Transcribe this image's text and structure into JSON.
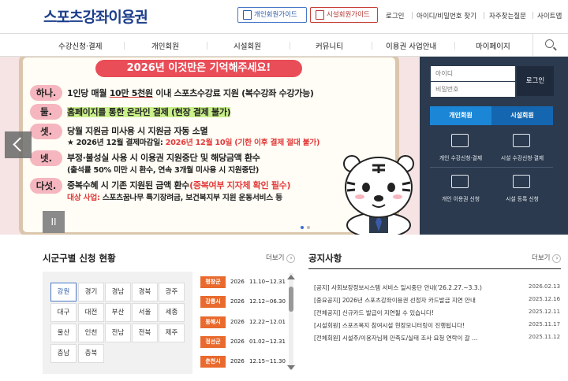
{
  "header": {
    "logo": "스포츠강좌이용권",
    "guide_personal": "개인회원가이드",
    "guide_facility": "시설회원가이드",
    "util": [
      "로그인",
      "아이디/비밀번호 찾기",
      "자주찾는질문",
      "사이트맵"
    ]
  },
  "nav": {
    "items": [
      "수강신청·결제",
      "개인회원",
      "시설회원",
      "커뮤니티",
      "이용권 사업안내",
      "마이페이지"
    ]
  },
  "banner": {
    "headline": "2026년 이것만은 기억해주세요!",
    "tags": [
      "하나.",
      "둘.",
      "셋.",
      "넷.",
      "다섯."
    ],
    "line1a": "1인당 매월 ",
    "line1b": "10만 5천원",
    "line1c": " 이내 스포츠수강료 지원 (복수강좌 수강가능)",
    "line2": "홈페이지를 통한 온라인 결제 (현장 결제 불가)",
    "line3": "당월 지원금 미사용 시 지원금 자동 소멸",
    "line3sub_a": "★ 2026년 12월 결제마감일: ",
    "line3sub_b": "2026년 12월 10일 (기한 이후 결제 절대 불가)",
    "line4": "부정·불성실 사용 시 이용권 지원중단 및 해당금액 환수",
    "line4sub": "(출석률 50% 미만 시 환수, 연속 3개월 미사용 시 지원중단)",
    "line5a": "중복수혜 시 기존 지원된 금액 환수",
    "line5b": "(중복여부 지자체 확인 필수)",
    "line6a": "대상 사업: ",
    "line6b": "스포츠꿈나무 특기장려금, 보건복지부 지원 운동서비스 등",
    "pause": "II"
  },
  "login": {
    "id_placeholder": "아이디",
    "pw_placeholder": "비밀번호",
    "button": "로그인",
    "tab_personal": "개인회원",
    "tab_facility": "시설회원",
    "quick": [
      "개인 수강신청·결제",
      "시설 수강신청·결제",
      "개인 이용권 신청",
      "시설 등록 신청"
    ]
  },
  "region": {
    "title": "시군구별 신청 현황",
    "more": "더보기",
    "cells": [
      "강원",
      "경기",
      "경남",
      "경북",
      "광주",
      "대구",
      "대전",
      "부산",
      "서울",
      "세종",
      "울산",
      "인천",
      "전남",
      "전북",
      "제주",
      "충남",
      "충북"
    ],
    "schedule": [
      {
        "place": "평창군",
        "year": "2026",
        "date": "11.10~12.31"
      },
      {
        "place": "강릉시",
        "year": "2026",
        "date": "12.12~06.30"
      },
      {
        "place": "동해시",
        "year": "2026",
        "date": "12.22~12.01"
      },
      {
        "place": "정선군",
        "year": "2026",
        "date": "01.02~12.31"
      },
      {
        "place": "춘천시",
        "year": "2026",
        "date": "12.15~11.30"
      }
    ]
  },
  "notice": {
    "title": "공지사항",
    "more": "더보기",
    "items": [
      {
        "text": "[공지] 사회보장정보시스템 서비스 일시중단 안내('26.2.27.~3.3.)",
        "date": "2026.02.13"
      },
      {
        "text": "[중요공지] 2026년 스포츠강좌이용권 선정자 카드발급 지연 안내",
        "date": "2025.12.16"
      },
      {
        "text": "[전체공지] 신규카드 발급이 지연될 수 있습니다!",
        "date": "2025.12.11"
      },
      {
        "text": "[시설회원] 스포츠복지 참여시설 현장모니터링이 진행됩니다!",
        "date": "2025.11.17"
      },
      {
        "text": "[전체회원] 시설주/이용자님께 만족도/실태 조사 요청 연락이 갈 …",
        "date": "2025.11.12"
      }
    ]
  },
  "colors": {
    "brand": "#1d3f8c",
    "accent_red": "#e94d58",
    "login_bg": "#2b3a4e",
    "tab_blue": "#1b86d6",
    "badge_orange": "#e96a2e"
  }
}
